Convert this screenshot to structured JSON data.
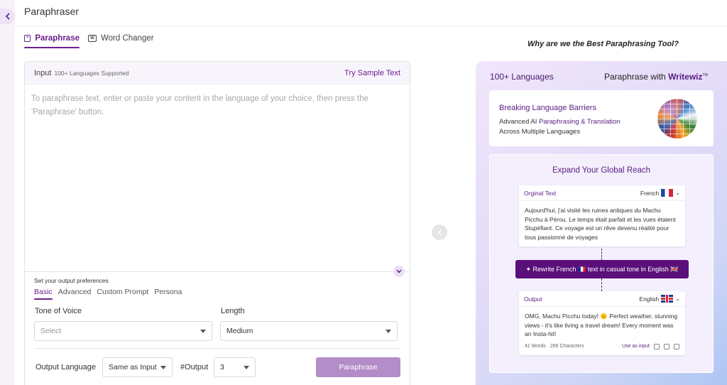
{
  "page": {
    "title": "Paraphraser"
  },
  "tabs": [
    {
      "label": "Paraphrase",
      "icon": "quote-icon",
      "active": true
    },
    {
      "label": "Word Changer",
      "icon": "word-icon",
      "active": false
    }
  ],
  "editor": {
    "input_label": "Input",
    "input_sub": "100+ Languages Supported",
    "try_sample": "Try Sample Text",
    "placeholder": "To paraphrase text, enter or paste your content in the language of your choice, then press the 'Paraphrase' button.",
    "prefs_title": "Set your output preferences",
    "pref_tabs": [
      "Basic",
      "Advanced",
      "Custom Prompt",
      "Persona"
    ],
    "tone_label": "Tone of Voice",
    "tone_placeholder": "Select",
    "length_label": "Length",
    "length_value": "Medium",
    "output_language_label": "Output Language",
    "output_language_value": "Same as Input",
    "output_count_label": "#Output",
    "output_count_value": "3",
    "paraphrase_button": "Paraphrase",
    "button_color": "#b38dc7"
  },
  "promo": {
    "why": "Why are we the Best Paraphrasing Tool?",
    "languages": "100+ Languages",
    "brand_prefix": "Paraphrase with",
    "brand_name": "Writewiz",
    "brand_mark": "TM",
    "card1_heading": "Breaking Language Barriers",
    "card1_line1_prefix": "Advanced AI ",
    "card1_line1_highlight": "Paraphrasing & Translation",
    "card1_line2": "Across Multiple Languages",
    "card2_heading": "Expand Your Global Reach",
    "original_label": "Orginal Text",
    "original_lang": "French",
    "original_text": "Aujourd'hui, j'ai visité les ruines antiques du Machu Picchu à Pérou. Le temps était parfait et les vues étaient Stupéfiant. Ce voyage est un rêve devenu réalité pour tous passionné de voyages",
    "rewrite_label": "✦ Rewrite French 🇫🇷 text in casual tone in English 🇬🇧",
    "output_label": "Output",
    "output_lang": "English",
    "output_text": "OMG, Machu Picchu today! 🌞 Perfect weather, stunning views - it's like living a travel dream! Every moment was an Insta-hit!",
    "words": "41 Words",
    "characters": "289 Characters",
    "use_as_input": "Use as input",
    "accent": "#5a1d80"
  }
}
